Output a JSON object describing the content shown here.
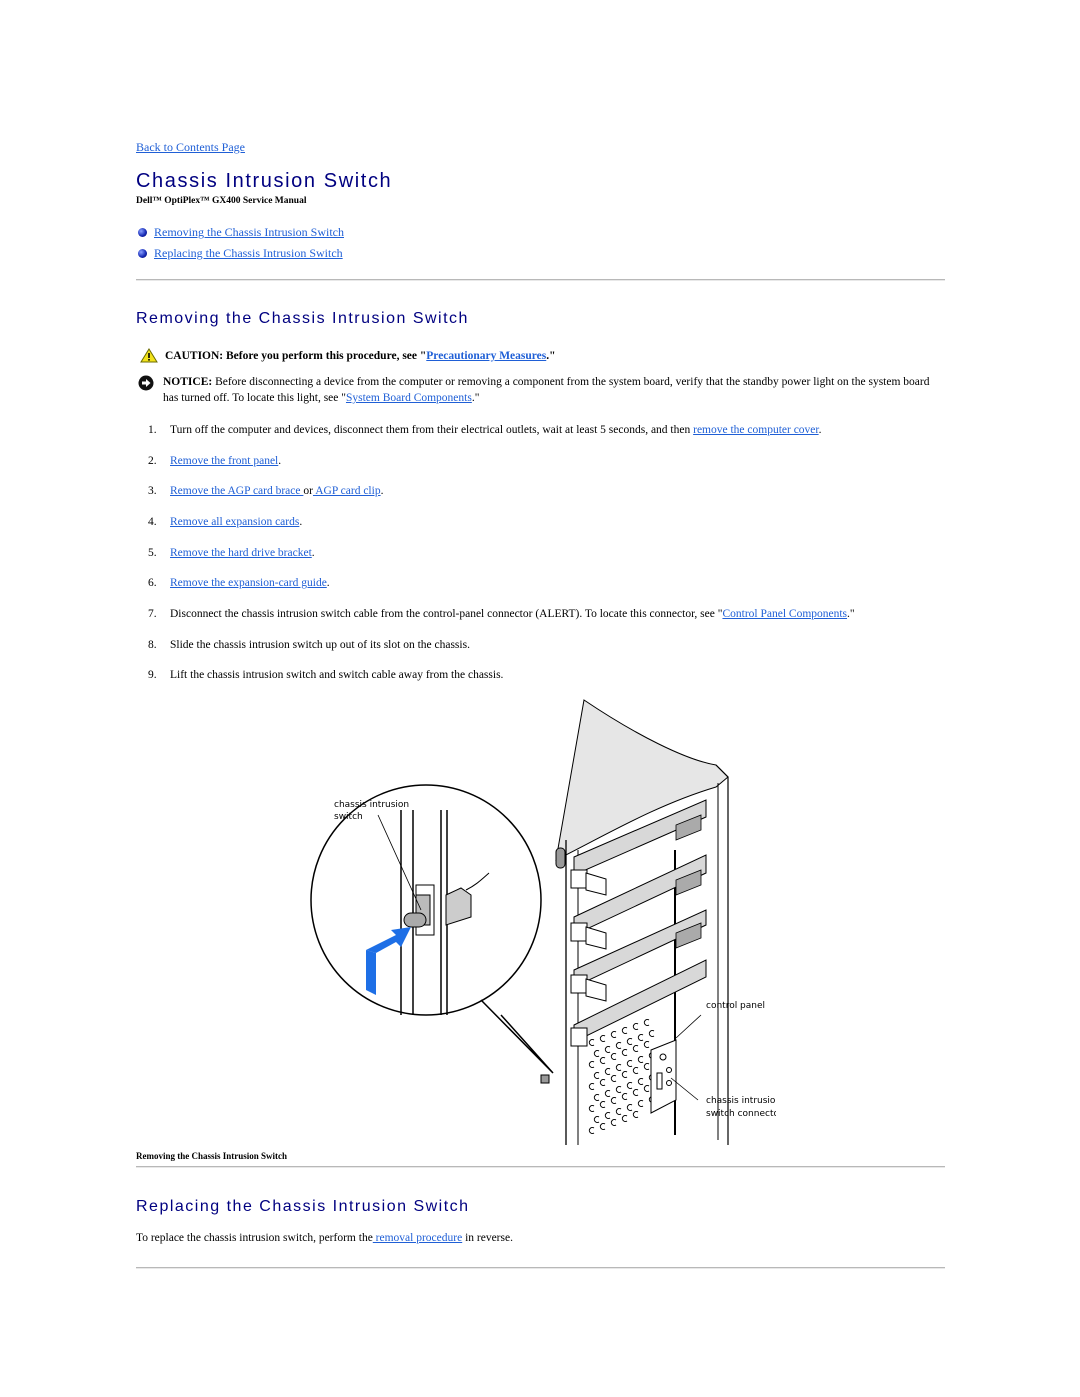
{
  "nav": {
    "back_link": "Back to Contents Page"
  },
  "header": {
    "title": "Chassis Intrusion Switch",
    "subtitle": "Dell™ OptiPlex™ GX400 Service Manual"
  },
  "toc": [
    {
      "label": "Removing the Chassis Intrusion Switch"
    },
    {
      "label": "Replacing the Chassis Intrusion Switch"
    }
  ],
  "removing": {
    "heading": "Removing the Chassis Intrusion Switch",
    "caution": {
      "label": "CAUTION:",
      "text": " Before you perform this procedure, see \"",
      "link": "Precautionary Measures",
      "tail": ".\""
    },
    "notice": {
      "label": "NOTICE:",
      "text": " Before disconnecting a device from the computer or removing a component from the system board, verify that the standby power light on the system board has turned off. To locate this light, see \"",
      "link": "System Board Components",
      "tail": ".\""
    },
    "steps": [
      {
        "num": "1.",
        "pre": "Turn off the computer and devices, disconnect them from their electrical outlets, wait at least 5 seconds, and then ",
        "link": "remove the computer cover",
        "post": "."
      },
      {
        "num": "2.",
        "pre": "",
        "link": "Remove the front panel",
        "post": "."
      },
      {
        "num": "3.",
        "pre": "",
        "link": "Remove the AGP card brace ",
        "mid": "or",
        "link2": " AGP card clip",
        "post": "."
      },
      {
        "num": "4.",
        "pre": "",
        "link": "Remove all expansion cards",
        "post": "."
      },
      {
        "num": "5.",
        "pre": "",
        "link": "Remove the hard drive bracket",
        "post": "."
      },
      {
        "num": "6.",
        "pre": "",
        "link": "Remove the expansion-card guide",
        "post": "."
      },
      {
        "num": "7.",
        "pre": "Disconnect the chassis intrusion switch cable from the control-panel connector (ALERT). To locate this connector, see \"",
        "link": "Control Panel Components",
        "post": ".\""
      },
      {
        "num": "8.",
        "pre": "Slide the chassis intrusion switch up out of its slot on the chassis.",
        "link": "",
        "post": ""
      },
      {
        "num": "9.",
        "pre": "Lift the chassis intrusion switch and switch cable away from the chassis.",
        "link": "",
        "post": ""
      }
    ],
    "figure": {
      "labels": {
        "switch": [
          "chassis intrusion",
          "switch"
        ],
        "control_panel": "control panel",
        "connector": [
          "chassis intrusion",
          "switch connector"
        ]
      },
      "arrow_color": "#1e6fe6",
      "caption": "Removing the Chassis Intrusion Switch"
    }
  },
  "replacing": {
    "heading": "Replacing the Chassis Intrusion Switch",
    "text_pre": "To replace the chassis intrusion switch, perform the",
    "link": " removal procedure",
    "text_post": " in reverse."
  }
}
